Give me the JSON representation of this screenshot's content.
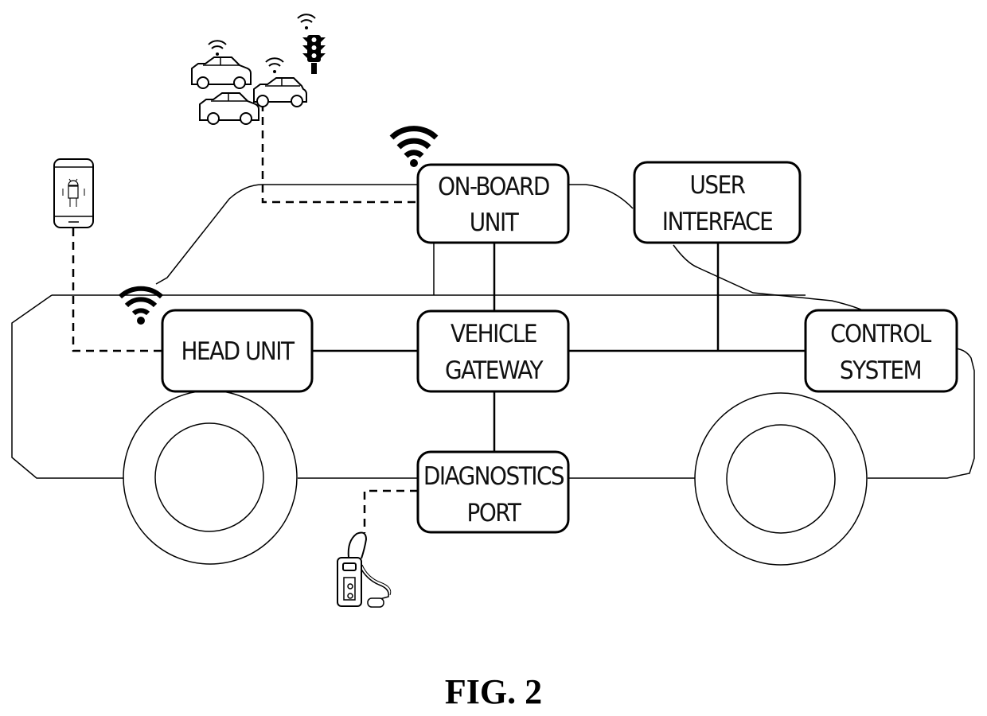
{
  "figure": {
    "caption": "FIG. 2",
    "subject": "vehicle network architecture"
  },
  "components": {
    "on_board_unit": {
      "line1": "ON-BOARD",
      "line2": "UNIT"
    },
    "user_interface": {
      "line1": "USER",
      "line2": "INTERFACE"
    },
    "head_unit": {
      "line1": "HEAD UNIT"
    },
    "vehicle_gateway": {
      "line1": "VEHICLE",
      "line2": "GATEWAY"
    },
    "control_system": {
      "line1": "CONTROL",
      "line2": "SYSTEM"
    },
    "diagnostics_port": {
      "line1": "DIAGNOSTICS",
      "line2": "PORT"
    }
  },
  "external_devices": [
    {
      "name": "smartphone",
      "icon": "android-smartphone-icon",
      "link": "wireless",
      "connects_to": "head_unit"
    },
    {
      "name": "other vehicles",
      "icon": "car-icon",
      "count": 3,
      "link": "wireless",
      "connects_to": "on_board_unit"
    },
    {
      "name": "traffic light",
      "icon": "traffic-light-icon",
      "link": "wireless",
      "connects_to": "on_board_unit"
    },
    {
      "name": "diagnostic scanner",
      "icon": "diagnostic-scanner-icon",
      "link": "wired",
      "connects_to": "diagnostics_port"
    }
  ],
  "connections": [
    {
      "from": "head_unit",
      "to": "vehicle_gateway",
      "type": "bus"
    },
    {
      "from": "on_board_unit",
      "to": "vehicle_gateway",
      "type": "bus"
    },
    {
      "from": "vehicle_gateway",
      "to": "control_system",
      "type": "bus"
    },
    {
      "from": "user_interface",
      "to": "control_system",
      "type": "bus"
    },
    {
      "from": "vehicle_gateway",
      "to": "diagnostics_port",
      "type": "bus"
    }
  ]
}
